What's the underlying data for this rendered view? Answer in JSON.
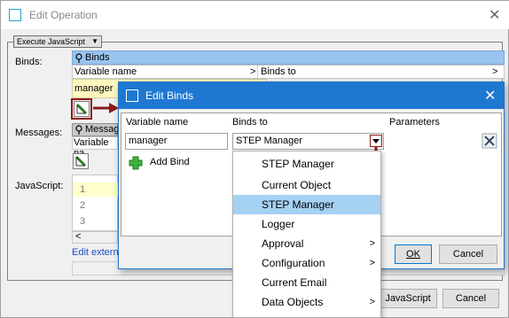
{
  "outer": {
    "title": "Edit Operation",
    "close": "✕",
    "type_select": "Execute JavaScript",
    "binds_label": "Binds:",
    "binds_header": "Binds",
    "col_variable": "Variable name",
    "col_binds_to": "Binds to",
    "col_arrow": ">",
    "bind_row_value": "manager",
    "messages_label": "Messages:",
    "messages_header": "Messag",
    "messages_col": "Variable na",
    "javascript_label": "JavaScript:",
    "line_numbers": [
      "1",
      "2",
      "3"
    ],
    "edit_external": "Edit extern",
    "js_button": "JavaScript",
    "cancel_button": "Cancel"
  },
  "dialog": {
    "title": "Edit Binds",
    "close": "✕",
    "col_variable": "Variable name",
    "col_binds_to": "Binds to",
    "col_parameters": "Parameters",
    "variable_value": "manager",
    "binds_to_value": "STEP Manager",
    "add_bind": "Add Bind",
    "ok_button": "OK",
    "cancel_button": "Cancel"
  },
  "dropdown": {
    "items": [
      {
        "label": "STEP Manager",
        "submenu": false
      },
      {
        "label": "Current Object",
        "submenu": false
      },
      {
        "label": "STEP Manager",
        "submenu": false,
        "selected": true
      },
      {
        "label": "Logger",
        "submenu": false
      },
      {
        "label": "Approval",
        "submenu": true
      },
      {
        "label": "Configuration",
        "submenu": true
      },
      {
        "label": "Current Email",
        "submenu": false
      },
      {
        "label": "Data Objects",
        "submenu": true
      }
    ],
    "submenu_glyph": ">"
  },
  "colors": {
    "dialog_titlebar": "#1e78d2",
    "highlight": "#a5d1f3",
    "annotation_arrow": "#8b1a1a"
  }
}
